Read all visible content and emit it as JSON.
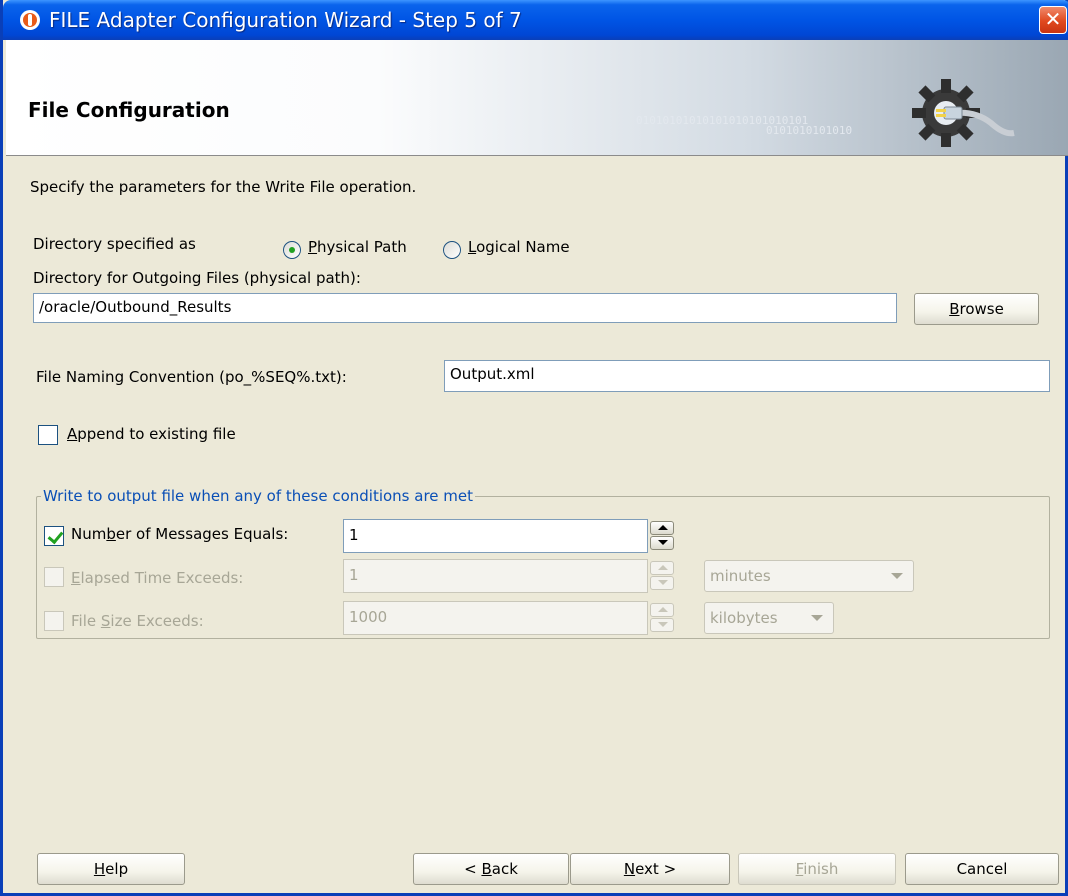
{
  "window": {
    "title": "FILE Adapter Configuration Wizard - Step 5 of 7",
    "close_glyph": "✕"
  },
  "header": {
    "title": "File Configuration",
    "binary_line1": "01010101010101010101010101",
    "binary_line2": "0101010101010"
  },
  "intro": "Specify the parameters for the Write File operation.",
  "directory": {
    "label": "Directory specified as",
    "physical": {
      "prefix": "",
      "mnemonic": "P",
      "suffix": "hysical Path",
      "selected": true
    },
    "logical": {
      "prefix": "",
      "mnemonic": "L",
      "suffix": "ogical Name",
      "selected": false
    },
    "outgoing_label": "Directory for Outgoing Files (physical path):",
    "outgoing_value": "/oracle/Outbound_Results",
    "browse": {
      "prefix": "",
      "mnemonic": "B",
      "suffix": "rowse"
    }
  },
  "naming": {
    "label": "File Naming Convention (po_%SEQ%.txt):",
    "value": "Output.xml"
  },
  "append": {
    "prefix": "",
    "mnemonic": "A",
    "suffix": "ppend to existing file",
    "checked": false
  },
  "conditions": {
    "legend": "Write to output file when any of these conditions are met",
    "messages": {
      "prefix": "Num",
      "mnemonic": "b",
      "suffix": "er of Messages Equals:",
      "value": "1",
      "checked": true,
      "enabled": true
    },
    "elapsed": {
      "prefix": "",
      "mnemonic": "E",
      "suffix": "lapsed Time Exceeds:",
      "value": "1",
      "checked": false,
      "enabled": false,
      "unit": "minutes"
    },
    "filesize": {
      "prefix": "File ",
      "mnemonic": "S",
      "suffix": "ize Exceeds:",
      "value": "1000",
      "checked": false,
      "enabled": false,
      "unit": "kilobytes"
    }
  },
  "footer": {
    "help": {
      "prefix": "",
      "mnemonic": "H",
      "suffix": "elp"
    },
    "back": {
      "prefix": "< ",
      "mnemonic": "B",
      "suffix": "ack"
    },
    "next": {
      "prefix": "",
      "mnemonic": "N",
      "suffix": "ext >"
    },
    "finish": {
      "prefix": "",
      "mnemonic": "F",
      "suffix": "inish",
      "enabled": false
    },
    "cancel": {
      "label": "Cancel"
    }
  },
  "icons": {
    "app": "oracle-logo-icon",
    "header": "gear-plug-icon"
  }
}
